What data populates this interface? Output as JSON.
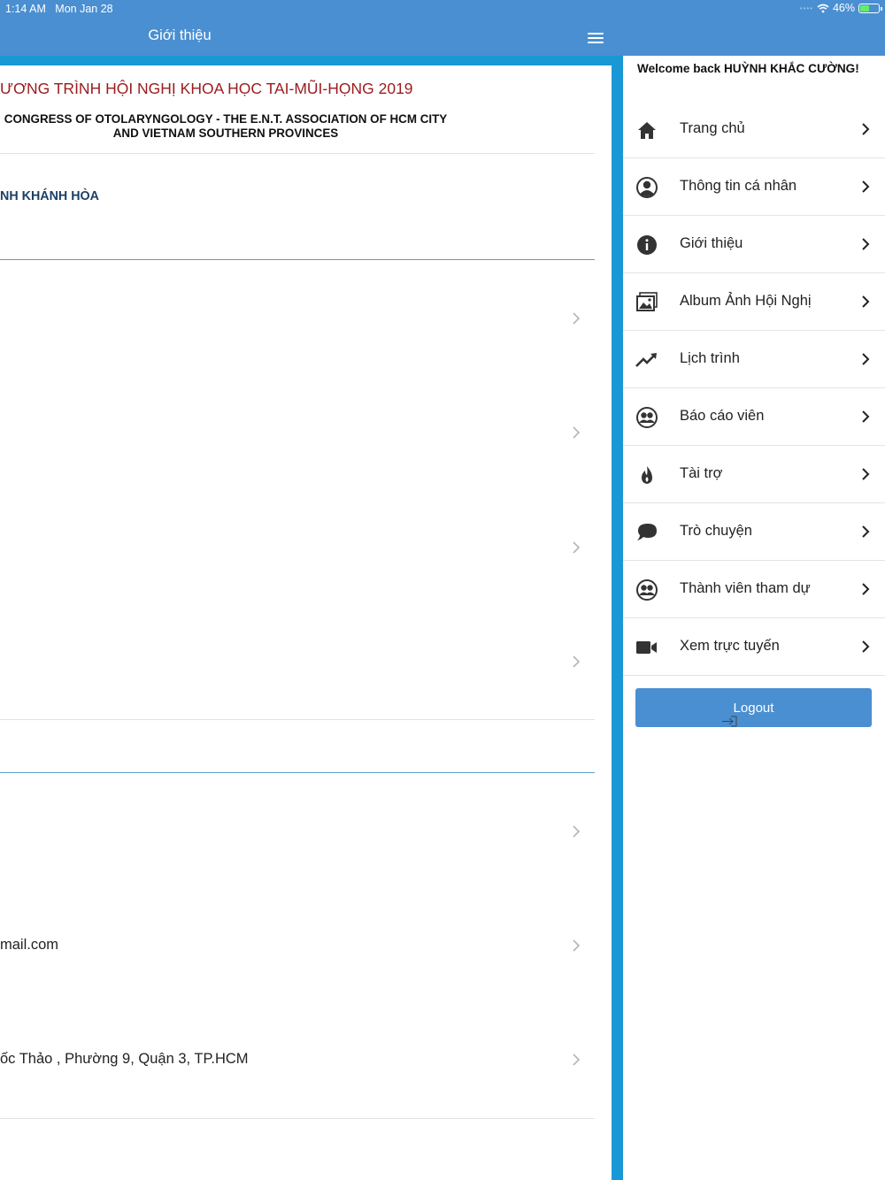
{
  "status_bar": {
    "time": "1:14 AM",
    "date": "Mon Jan 28",
    "battery": "46%",
    "wifi_icon": "wifi-icon",
    "battery_icon": "battery-charging-icon"
  },
  "header": {
    "title": "Giới thiệu",
    "menu_icon": "hamburger-menu-icon"
  },
  "content": {
    "title": "ƯƠNG TRÌNH HỘI NGHỊ KHOA HỌC TAI-MŨI-HỌNG 2019",
    "subtitle": "CONGRESS OF OTOLARYNGOLOGY - THE E.N.T. ASSOCIATION OF HCM CITY AND VIETNAM SOUTHERN PROVINCES",
    "organization": "NH KHÁNH HÒA",
    "rows": [
      "",
      "",
      "",
      "",
      "",
      "mail.com",
      "ốc Thảo , Phường 9, Quận 3, TP.HCM"
    ]
  },
  "drawer": {
    "welcome": "Welcome back HUỲNH KHẮC CƯỜNG!",
    "items": [
      {
        "label": "Trang chủ",
        "icon": "home-icon"
      },
      {
        "label": "Thông tin cá nhân",
        "icon": "user-circle-icon"
      },
      {
        "label": "Giới thiệu",
        "icon": "info-icon"
      },
      {
        "label": "Album Ảnh Hội Nghị",
        "icon": "photo-album-icon"
      },
      {
        "label": "Lịch trình",
        "icon": "trending-up-icon"
      },
      {
        "label": "Báo cáo viên",
        "icon": "group-icon"
      },
      {
        "label": "Tài trợ",
        "icon": "flame-icon"
      },
      {
        "label": "Trò chuyện",
        "icon": "chat-bubble-icon"
      },
      {
        "label": "Thành viên tham dự",
        "icon": "members-icon"
      },
      {
        "label": "Xem trực tuyến",
        "icon": "video-camera-icon"
      }
    ],
    "logout": "Logout",
    "logout_icon": "logout-icon"
  },
  "colors": {
    "header": "#4a8fd1",
    "accent_border": "#1a98d6",
    "title_red": "#9b1b1e",
    "org_blue": "#1d3f66"
  }
}
